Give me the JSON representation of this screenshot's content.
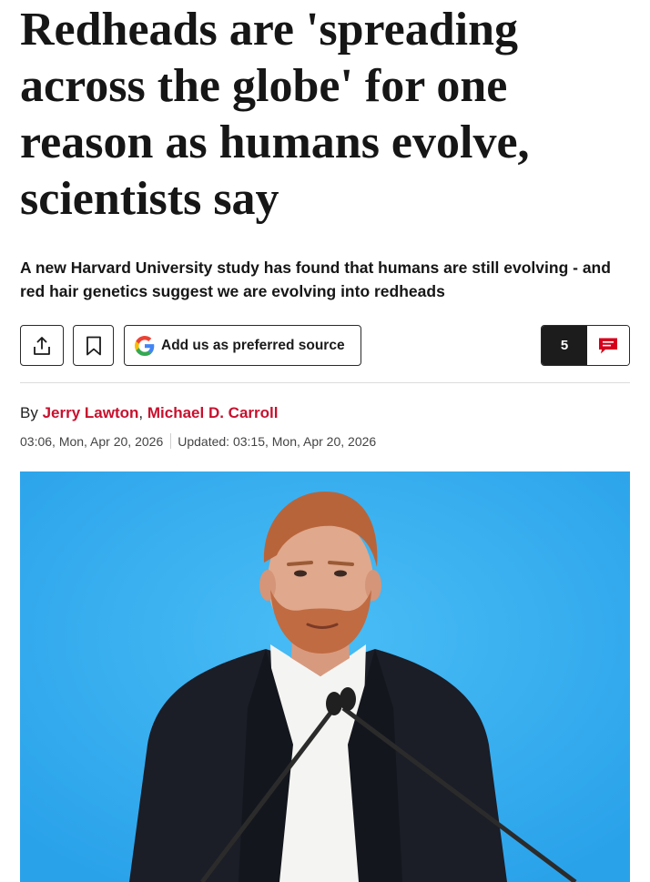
{
  "article": {
    "headline": "Redheads are 'spreading across the globe' for one reason as humans evolve, scientists say",
    "standfirst": "A new Harvard University study has found that humans are still evolving - and red hair genetics suggest we are evolving into redheads"
  },
  "actions": {
    "share_icon": "share-icon",
    "bookmark_icon": "bookmark-icon",
    "preferred_source_label": "Add us as preferred source",
    "google_icon": "google-g-icon",
    "comment_count": "5",
    "comment_icon": "comment-bubble-icon"
  },
  "byline": {
    "prefix": "By",
    "authors": [
      "Jerry Lawton",
      "Michael D. Carroll"
    ],
    "separator": ","
  },
  "dates": {
    "published": "03:06, Mon, Apr 20, 2026",
    "updated": "Updated: 03:15, Mon, Apr 20, 2026"
  },
  "colors": {
    "accent_red": "#c8102e",
    "comment_dark": "#1c1c1c",
    "hero_background": "#33abee"
  }
}
